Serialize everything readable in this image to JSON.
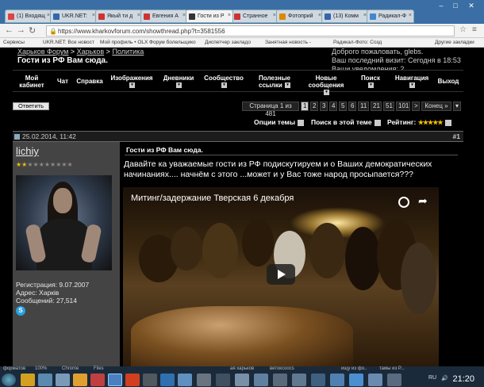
{
  "browser": {
    "tabs": [
      {
        "label": "(1) Входящ",
        "color": "#d44"
      },
      {
        "label": "UKR.NET: ",
        "color": "#36a"
      },
      {
        "label": "Якый ти д",
        "color": "#c33"
      },
      {
        "label": "Евгения А",
        "color": "#c33"
      },
      {
        "label": "Гости из Р",
        "color": "#333",
        "active": true
      },
      {
        "label": "Странное",
        "color": "#c33"
      },
      {
        "label": "Фотоприй",
        "color": "#d80"
      },
      {
        "label": "(13) Комм",
        "color": "#36a"
      },
      {
        "label": "Радикал-Ф",
        "color": "#48c"
      }
    ],
    "url": "https://www.kharkovforum.com/showthread.php?t=3581556",
    "bookmarks": [
      "Сервисы",
      "UKR.NET: Все новост",
      "Мой профиль • OLX",
      "Форум болельщико",
      "Диспетчер закладо",
      "Занятная новость - ",
      "Радикал-Фото: Созд",
      "Другие закладки"
    ]
  },
  "forum": {
    "breadcrumb": [
      "Харьков Форум",
      "Харьков",
      "Политика"
    ],
    "thread_title": "Гости из РФ Вам сюда.",
    "welcome_line1": "Доброго пожаловать, glebs.",
    "welcome_line2": "Ваш последний визит: Сегодня в 18:53",
    "welcome_line3": "Ваши уведомления: 2",
    "nav": [
      {
        "label": "Мой кабинет",
        "dd": false
      },
      {
        "label": "Чат",
        "dd": false
      },
      {
        "label": "Справка",
        "dd": false
      },
      {
        "label": "Изображения",
        "dd": true
      },
      {
        "label": "Дневники",
        "dd": true
      },
      {
        "label": "Сообщество",
        "dd": true
      },
      {
        "label": "Полезные ссылки",
        "dd": true
      },
      {
        "label": "Новые сообщения",
        "dd": true
      },
      {
        "label": "Поиск",
        "dd": true
      },
      {
        "label": "Навигация",
        "dd": true
      },
      {
        "label": "Выход",
        "dd": false
      }
    ],
    "reply_label": "Ответить",
    "pager": {
      "info": "Страница 1 из 481",
      "pages": [
        "1",
        "2",
        "3",
        "4",
        "5",
        "6",
        "11",
        "21",
        "51",
        "101",
        ">",
        "Конец »"
      ]
    },
    "tools": {
      "thread_options": "Опции темы",
      "search_thread": "Поиск в этой теме",
      "rating_label": "Рейтинг:",
      "rating_stars": "★★★★★"
    }
  },
  "post": {
    "date": "25.02.2014, 11:42",
    "number": "#1",
    "username": "lichiy",
    "reputation_on": "★★",
    "reputation_off": "★★★★★★★★",
    "reg_label": "Регистрация: 9.07.2007",
    "address_label": "Адрес: Харків",
    "messages_label": "Сообщений: 27,514",
    "title": "Гости из РФ Вам сюда.",
    "text": "Давайте ка уважаемые гости из РФ подискутируем и о Ваших демократических начинаниях.... начнём с этого ...может и у Вас тоже народ просыпается???",
    "video_title": "Митинг/задержание Тверская 6 декабря"
  },
  "taskbar": {
    "labels": [
      "форматов",
      "100%",
      "Chrome",
      "Files",
      "ая харьков",
      "ветоксоосs",
      "ищу из фо..",
      "тамы  из Р..."
    ],
    "tray_lang": "RU",
    "clock": "21:20"
  }
}
